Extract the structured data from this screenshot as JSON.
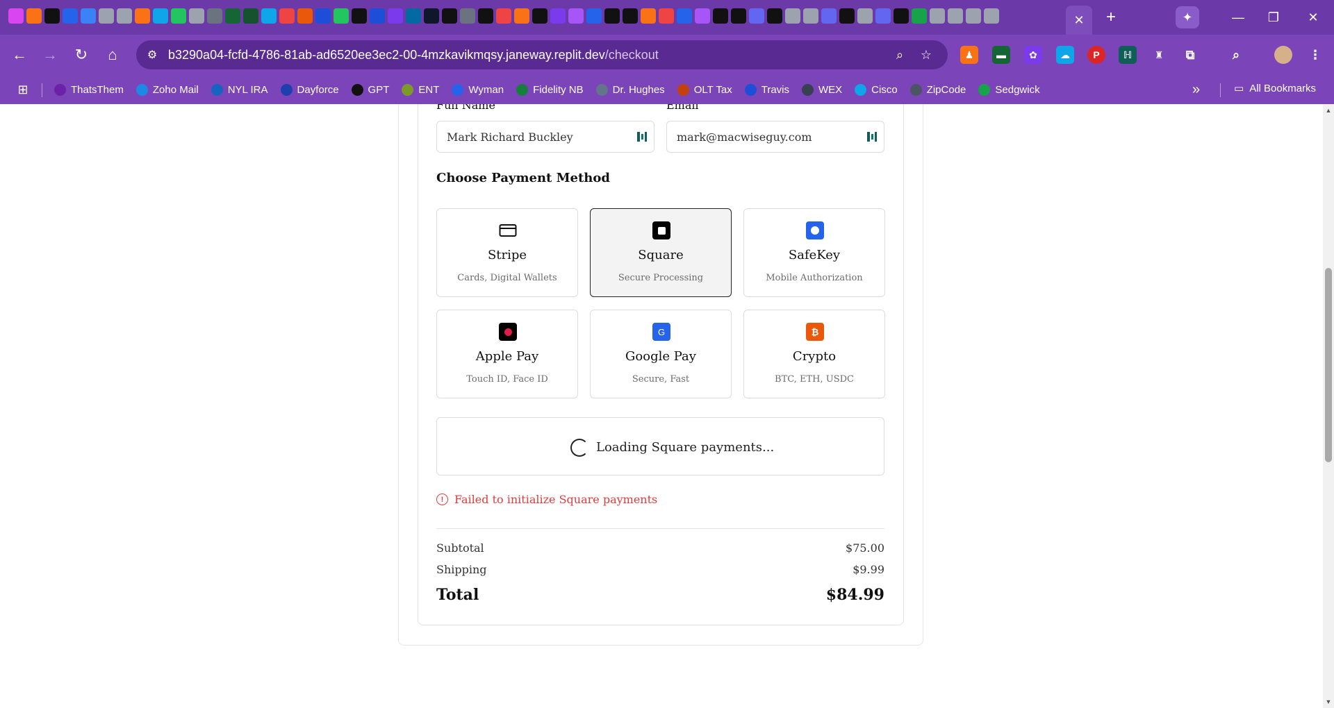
{
  "browser": {
    "url_host": "b3290a04-fcfd-4786-81ab-ad6520ee3ec2-00-4mzkavikmqsy.janeway.replit.dev",
    "url_path": "/checkout",
    "bookmarks": [
      {
        "label": "ThatsThem",
        "color": "#6b21a8",
        "glyph": "T"
      },
      {
        "label": "Zoho Mail",
        "color": "#1e88e5",
        "glyph": "Z"
      },
      {
        "label": "NYL IRA",
        "color": "#1565c0",
        "glyph": "N"
      },
      {
        "label": "Dayforce",
        "color": "#1e40af",
        "glyph": "D"
      },
      {
        "label": "GPT",
        "color": "#111111",
        "glyph": "G"
      },
      {
        "label": "ENT",
        "color": "#7c9a2a",
        "glyph": "E"
      },
      {
        "label": "Wyman",
        "color": "#2563eb",
        "glyph": "W"
      },
      {
        "label": "Fidelity NB",
        "color": "#15803d",
        "glyph": "F"
      },
      {
        "label": "Dr. Hughes",
        "color": "#64748b",
        "glyph": "D"
      },
      {
        "label": "OLT Tax",
        "color": "#c2410c",
        "glyph": "O"
      },
      {
        "label": "Travis",
        "color": "#1d4ed8",
        "glyph": "T"
      },
      {
        "label": "WEX",
        "color": "#374151",
        "glyph": "W"
      },
      {
        "label": "Cisco",
        "color": "#0ea5e9",
        "glyph": "C"
      },
      {
        "label": "ZipCode",
        "color": "#4b5563",
        "glyph": "Z"
      },
      {
        "label": "Sedgwick",
        "color": "#16a34a",
        "glyph": "S"
      }
    ],
    "all_bookmarks_label": "All Bookmarks"
  },
  "form": {
    "full_name_label": "Full Name",
    "full_name_value": "Mark Richard Buckley",
    "email_label": "Email",
    "email_value": "mark@macwiseguy.com"
  },
  "payment": {
    "section_title": "Choose Payment Method",
    "selected": "Square",
    "methods": [
      {
        "name": "Stripe",
        "subtitle": "Cards, Digital Wallets",
        "icon": "credit-card-icon",
        "icon_color": "#ffffff"
      },
      {
        "name": "Square",
        "subtitle": "Secure Processing",
        "icon": "square-icon",
        "icon_color": "#000000"
      },
      {
        "name": "SafeKey",
        "subtitle": "Mobile Authorization",
        "icon": "safekey-icon",
        "icon_color": "#2563eb"
      },
      {
        "name": "Apple Pay",
        "subtitle": "Touch ID, Face ID",
        "icon": "apple-icon",
        "icon_color": "#000000"
      },
      {
        "name": "Google Pay",
        "subtitle": "Secure, Fast",
        "icon": "google-icon",
        "icon_color": "#2563eb"
      },
      {
        "name": "Crypto",
        "subtitle": "BTC, ETH, USDC",
        "icon": "bitcoin-icon",
        "icon_color": "#ea580c"
      }
    ],
    "loading_text": "Loading Square payments...",
    "error_text": "Failed to initialize Square payments",
    "error_color": "#e23b3b"
  },
  "summary": {
    "subtotal_label": "Subtotal",
    "subtotal_value": "$75.00",
    "shipping_label": "Shipping",
    "shipping_value": "$9.99",
    "total_label": "Total",
    "total_value": "$84.99"
  }
}
